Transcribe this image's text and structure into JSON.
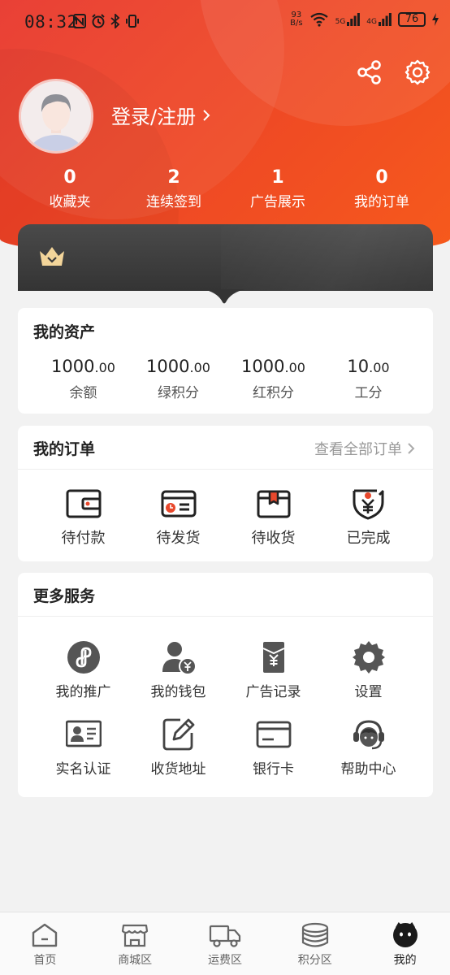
{
  "status_bar": {
    "time": "08:32",
    "net_speed_value": "93",
    "net_speed_unit": "B/s",
    "signal1": "5G",
    "signal2": "4G",
    "battery": "76"
  },
  "user": {
    "login_label": "登录/注册"
  },
  "stats": [
    {
      "value": "0",
      "label": "收藏夹"
    },
    {
      "value": "2",
      "label": "连续签到"
    },
    {
      "value": "1",
      "label": "广告展示"
    },
    {
      "value": "0",
      "label": "我的订单"
    }
  ],
  "assets": {
    "title": "我的资产",
    "items": [
      {
        "int": "1000",
        "dec": ".00",
        "label": "余额"
      },
      {
        "int": "1000",
        "dec": ".00",
        "label": "绿积分"
      },
      {
        "int": "1000",
        "dec": ".00",
        "label": "红积分"
      },
      {
        "int": "10",
        "dec": ".00",
        "label": "工分"
      }
    ]
  },
  "orders": {
    "title": "我的订单",
    "view_all": "查看全部订单",
    "items": [
      {
        "label": "待付款",
        "icon": "wallet-icon"
      },
      {
        "label": "待发货",
        "icon": "shipping-card-icon"
      },
      {
        "label": "待收货",
        "icon": "package-box-icon"
      },
      {
        "label": "已完成",
        "icon": "completed-yen-icon"
      }
    ]
  },
  "services": {
    "title": "更多服务",
    "items": [
      {
        "label": "我的推广",
        "icon": "promotion-icon"
      },
      {
        "label": "我的钱包",
        "icon": "user-wallet-icon"
      },
      {
        "label": "广告记录",
        "icon": "ad-record-icon"
      },
      {
        "label": "设置",
        "icon": "gear-icon"
      },
      {
        "label": "实名认证",
        "icon": "id-card-icon"
      },
      {
        "label": "收货地址",
        "icon": "edit-address-icon"
      },
      {
        "label": "银行卡",
        "icon": "bank-card-icon"
      },
      {
        "label": "帮助中心",
        "icon": "headset-icon"
      }
    ]
  },
  "bottom_nav": [
    {
      "label": "首页",
      "icon": "home-icon"
    },
    {
      "label": "商城区",
      "icon": "store-icon"
    },
    {
      "label": "运费区",
      "icon": "truck-icon"
    },
    {
      "label": "积分区",
      "icon": "coins-icon"
    },
    {
      "label": "我的",
      "icon": "profile-icon",
      "active": true
    }
  ],
  "colors": {
    "header_start": "#e8352a",
    "header_end": "#f65a1c",
    "accent": "#e8482c",
    "vip_card": "#3a3a3a",
    "crown": "#f3d59a"
  }
}
